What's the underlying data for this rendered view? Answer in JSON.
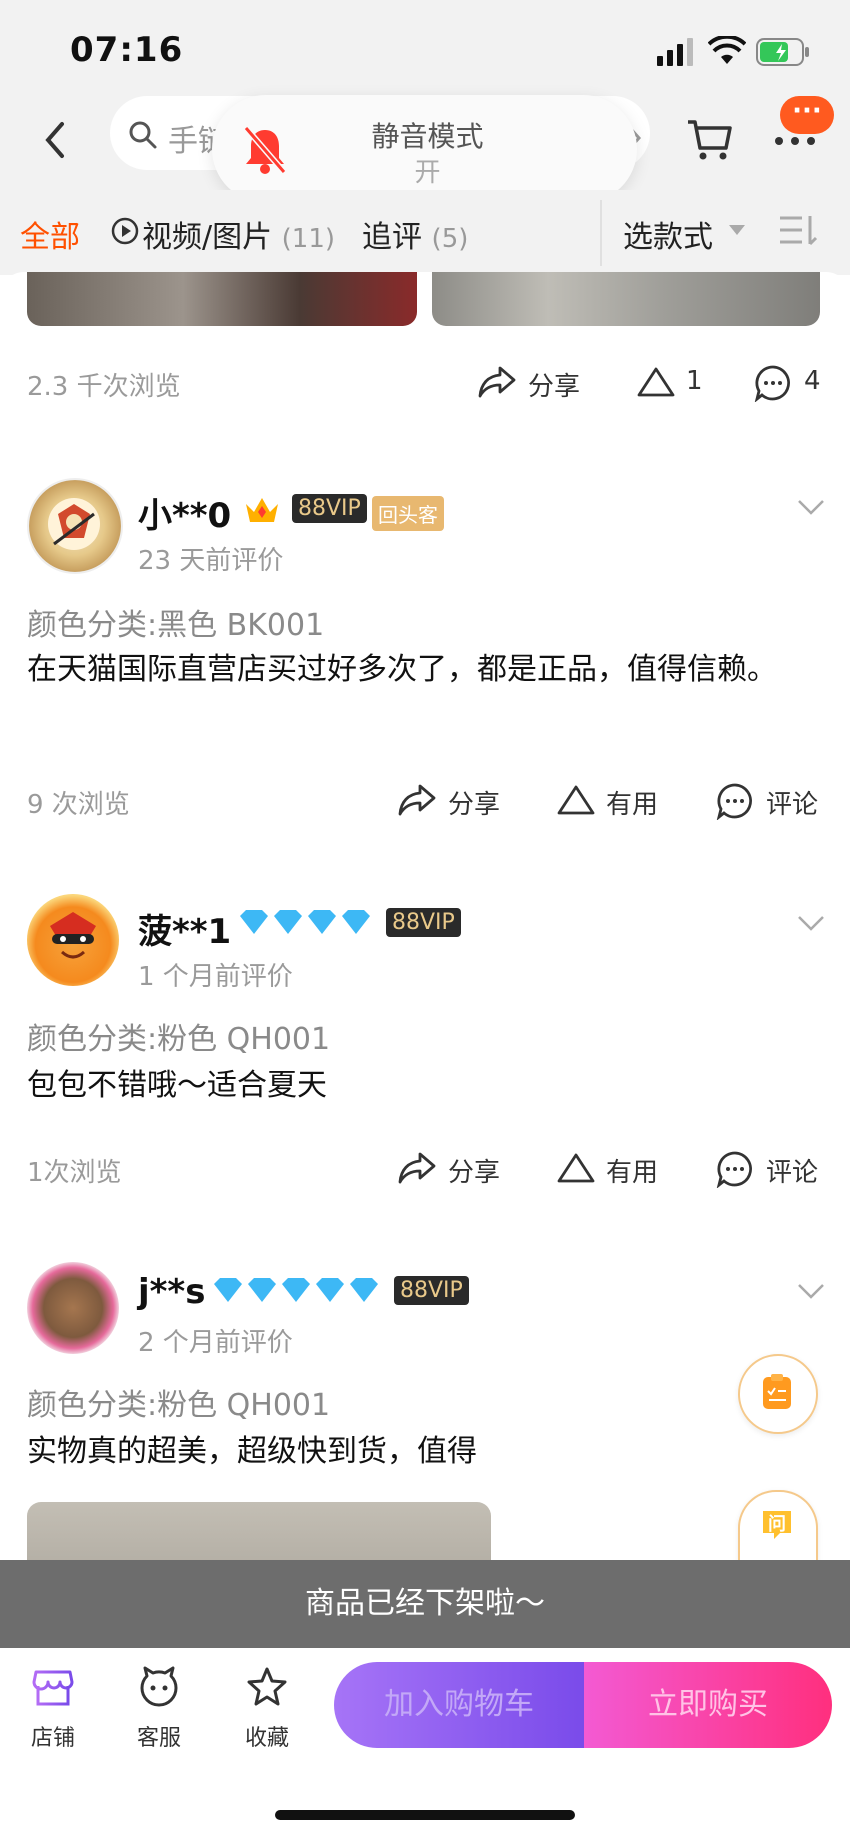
{
  "status_bar": {
    "time": "07:16"
  },
  "search": {
    "placeholder": "手链"
  },
  "toast": {
    "title": "静音模式",
    "subtitle": "开"
  },
  "more_badge": "···",
  "filters": {
    "tabs": [
      {
        "label": "全部"
      },
      {
        "label": "视频/图片",
        "count": "(11)"
      },
      {
        "label": "追评",
        "count": "(5)"
      }
    ],
    "select_style": "选款式"
  },
  "top_post": {
    "views": "2.3 千次浏览",
    "share": "分享",
    "useful": "1",
    "comments": "4"
  },
  "reviews": [
    {
      "user": "小**0",
      "vip": "88VIP",
      "badge": "回头客",
      "time": "23 天前评价",
      "variant": "颜色分类:黑色 BK001",
      "text": "在天猫国际直营店买过好多次了，都是正品，值得信赖。",
      "views": "9 次浏览",
      "share": "分享",
      "useful": "有用",
      "comment": "评论"
    },
    {
      "user": "菠**1",
      "vip": "88VIP",
      "time": "1 个月前评价",
      "variant": "颜色分类:粉色 QH001",
      "text": "包包不错哦～适合夏天",
      "views": "1次浏览",
      "share": "分享",
      "useful": "有用",
      "comment": "评论"
    },
    {
      "user": "j**s",
      "vip": "88VIP",
      "time": "2 个月前评价",
      "variant": "颜色分类:粉色 QH001",
      "text": "实物真的超美，超级快到货，值得"
    }
  ],
  "float_buttons": {
    "ask": "问"
  },
  "notice": "商品已经下架啦～",
  "bottom": {
    "shop": "店铺",
    "service": "客服",
    "favorite": "收藏",
    "add_cart": "加入购物车",
    "buy_now": "立即购买"
  },
  "colors": {
    "accent": "#ff5000",
    "vip_bg": "#2a2a2a",
    "diamond": "#3db8f5"
  }
}
